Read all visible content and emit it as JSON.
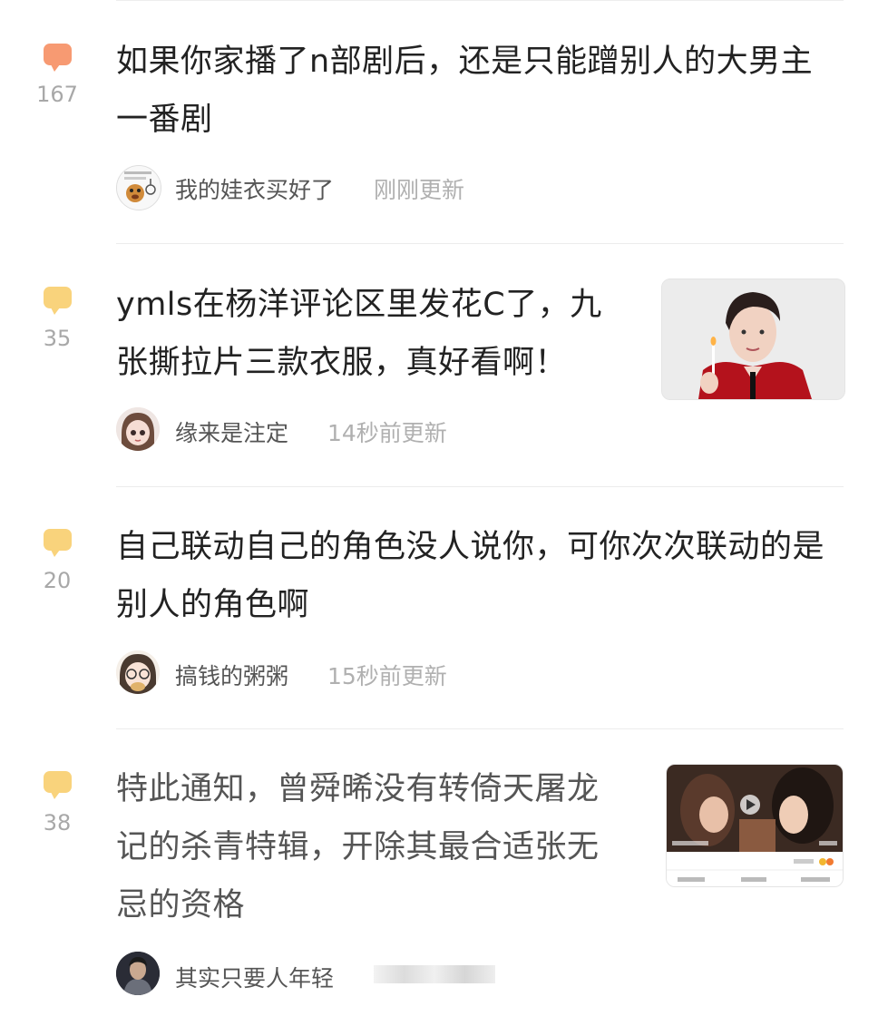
{
  "posts": [
    {
      "count": "167",
      "title": "如果你家播了n部剧后，还是只能蹭别人的大男主一番剧",
      "user": "我的娃衣买好了",
      "time": "刚刚更新",
      "icon_color": "#f79a72"
    },
    {
      "count": "35",
      "title": "ymls在杨洋评论区里发花C了，九张撕拉片三款衣服，真好看啊！",
      "user": "缘来是注定",
      "time": "14秒前更新",
      "icon_color": "#f9d37c"
    },
    {
      "count": "20",
      "title": "自己联动自己的角色没人说你，可你次次联动的是别人的角色啊",
      "user": "搞钱的粥粥",
      "time": "15秒前更新",
      "icon_color": "#f9d37c"
    },
    {
      "count": "38",
      "title": "特此通知，曾舜晞没有转倚天屠龙记的杀青特辑，开除其最合适张无忌的资格",
      "user": "其实只要人年轻",
      "time": "",
      "icon_color": "#f9d37c"
    }
  ]
}
